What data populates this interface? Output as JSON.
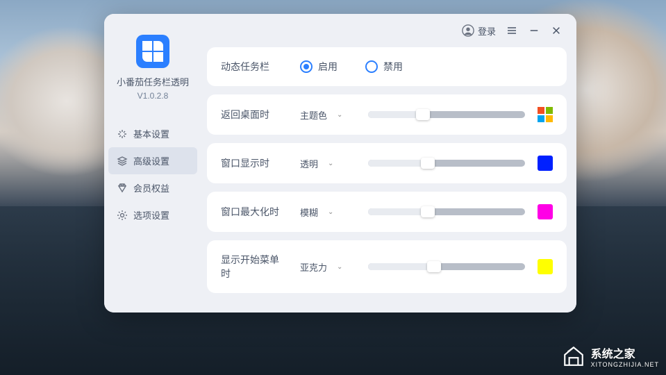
{
  "app": {
    "title": "小番茄任务栏透明",
    "version": "V1.0.2.8"
  },
  "titlebar": {
    "login": "登录"
  },
  "sidebar": {
    "items": [
      {
        "label": "基本设置"
      },
      {
        "label": "高级设置"
      },
      {
        "label": "会员权益"
      },
      {
        "label": "选项设置"
      }
    ],
    "activeIndex": 1
  },
  "settings": {
    "dynamicTaskbar": {
      "label": "动态任务栏",
      "options": {
        "enable": "启用",
        "disable": "禁用"
      },
      "value": "enable"
    },
    "rows": [
      {
        "label": "返回桌面时",
        "dropdown": "主题色",
        "sliderPercent": 35,
        "color": "ms"
      },
      {
        "label": "窗口显示时",
        "dropdown": "透明",
        "sliderPercent": 38,
        "color": "#0020ff"
      },
      {
        "label": "窗口最大化时",
        "dropdown": "模糊",
        "sliderPercent": 38,
        "color": "#ff00e6"
      },
      {
        "label": "显示开始菜单时",
        "dropdown": "亚克力",
        "sliderPercent": 42,
        "color": "#ffff00"
      }
    ]
  },
  "watermark": {
    "brand": "系统之家",
    "url": "XITONGZHIJIA.NET"
  }
}
